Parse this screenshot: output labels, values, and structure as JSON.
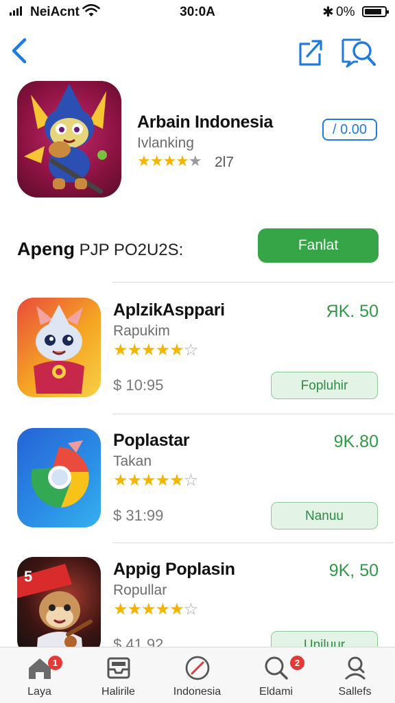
{
  "status_bar": {
    "carrier": "NeiAcnt",
    "time": "30:0A",
    "battery_percent": "0%",
    "bluetooth_glyph": "✱"
  },
  "nav": {
    "back_icon": "chevron-left-icon",
    "share_icon": "share-icon",
    "search_icon": "search-icon"
  },
  "featured": {
    "name": "Arbain Indonesia",
    "subtitle": "Ivlanking",
    "stars": "★★★★",
    "stars_off": "★",
    "rating_count": "2l7",
    "price": "/ 0.00"
  },
  "section": {
    "title_bold": "Apeng",
    "title_rest": " PJP PO2U2S:",
    "button_label": "Fanlat"
  },
  "apps": [
    {
      "name": "AplzikAsppari",
      "subtitle": "Rapukim",
      "stars": "★★★★★",
      "stars_off": "☆",
      "price": "ЯK. 50",
      "meta": "$ 10:95",
      "action": "Fopluhir"
    },
    {
      "name": "Poplastar",
      "subtitle": "Takan",
      "stars": "★★★★★",
      "stars_off": "☆",
      "price": "9K.80",
      "meta": "$ 31:99",
      "action": "Nanuu"
    },
    {
      "name": "Appig Poplasin",
      "subtitle": "Ropullar",
      "stars": "★★★★★",
      "stars_off": "☆",
      "price": "9K, 50",
      "meta": "$ 41.92",
      "action": "Uniluur"
    }
  ],
  "tabbar": {
    "tabs": [
      {
        "label": "Laya",
        "icon": "home-icon",
        "badge": "1"
      },
      {
        "label": "Halirile",
        "icon": "tray-icon",
        "badge": ""
      },
      {
        "label": "Indonesia",
        "icon": "compass-icon",
        "badge": ""
      },
      {
        "label": "Eldami",
        "icon": "search-icon",
        "badge": "2"
      },
      {
        "label": "Sallefs",
        "icon": "profile-search-icon",
        "badge": ""
      }
    ]
  },
  "colors": {
    "accent_blue": "#1f7ae0",
    "green": "#36a547",
    "star": "#f4b400",
    "badge": "#e53935"
  }
}
